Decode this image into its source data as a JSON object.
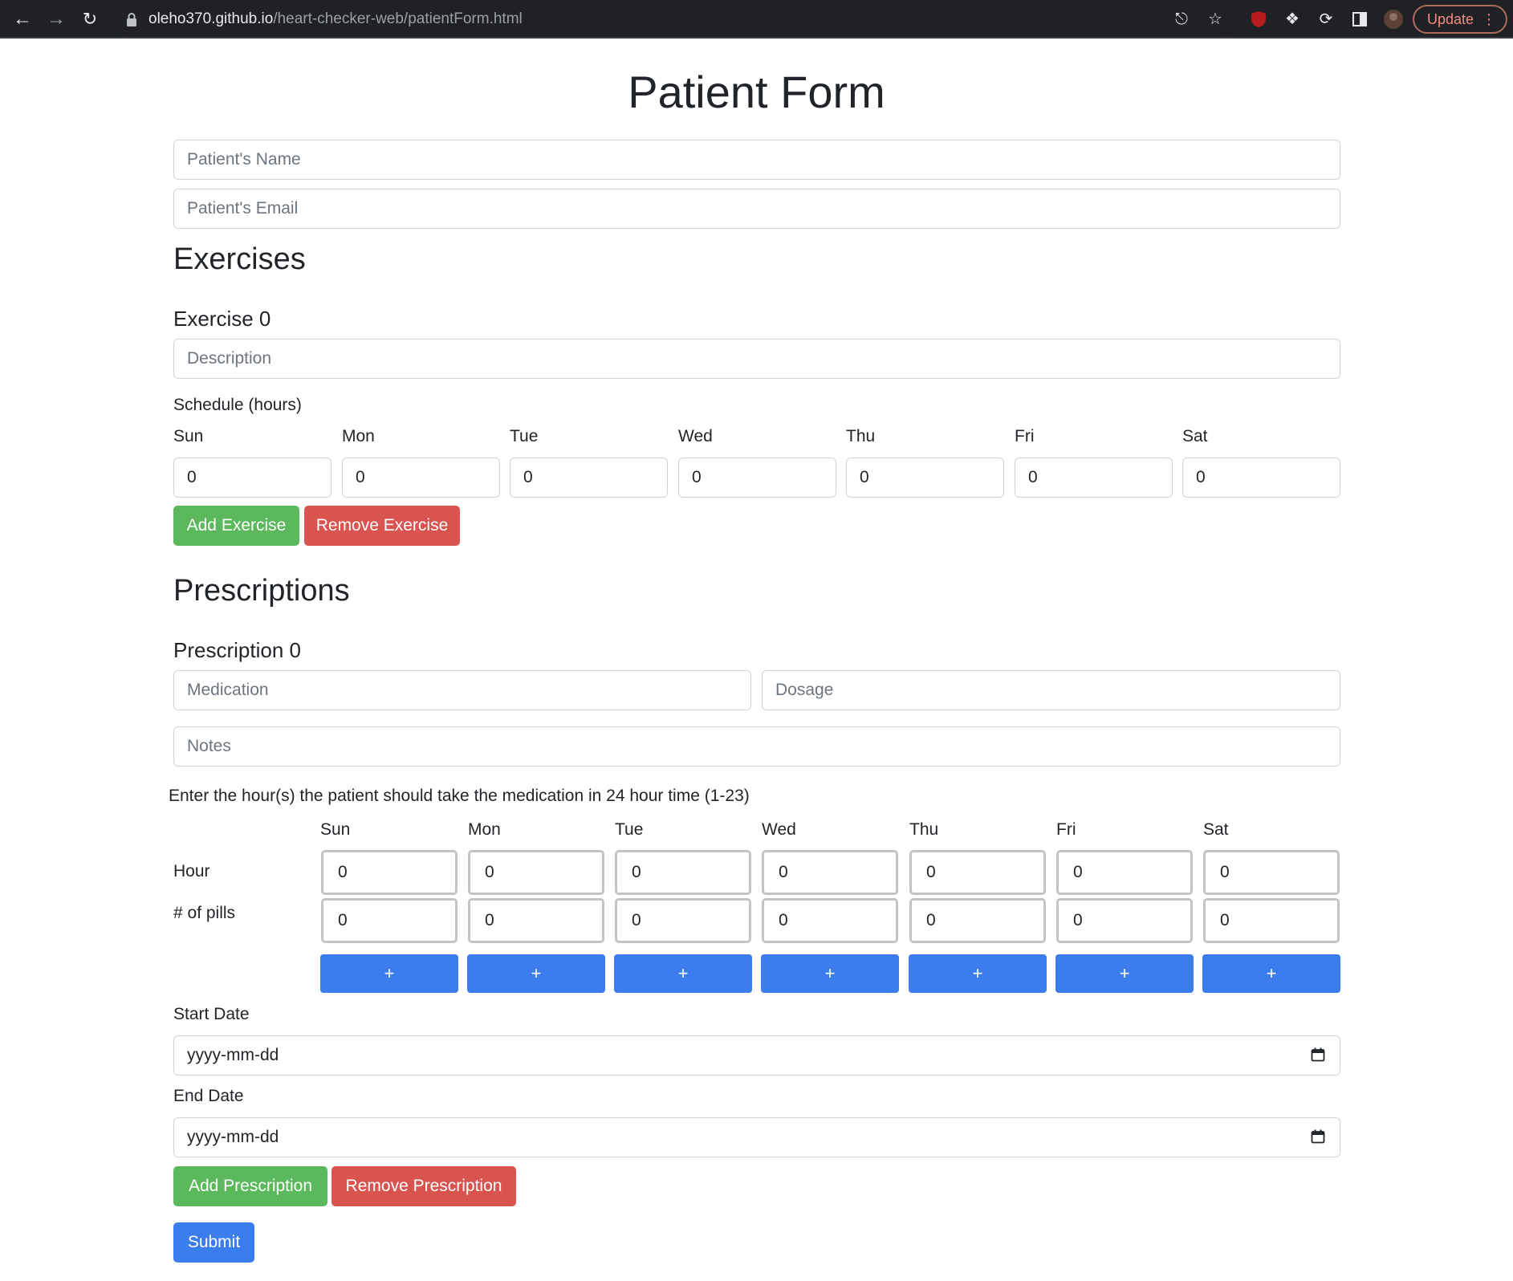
{
  "browser": {
    "url_host": "oleho370.github.io",
    "url_path": "/heart-checker-web/patientForm.html",
    "update_label": "Update"
  },
  "page": {
    "title": "Patient Form",
    "name_placeholder": "Patient's Name",
    "email_placeholder": "Patient's Email"
  },
  "exercises": {
    "heading": "Exercises",
    "item_title": "Exercise 0",
    "description_placeholder": "Description",
    "schedule_label": "Schedule (hours)",
    "days": [
      "Sun",
      "Mon",
      "Tue",
      "Wed",
      "Thu",
      "Fri",
      "Sat"
    ],
    "hours": [
      "0",
      "0",
      "0",
      "0",
      "0",
      "0",
      "0"
    ],
    "add_label": "Add Exercise",
    "remove_label": "Remove Exercise"
  },
  "prescriptions": {
    "heading": "Prescriptions",
    "item_title": "Prescription 0",
    "medication_placeholder": "Medication",
    "dosage_placeholder": "Dosage",
    "notes_placeholder": "Notes",
    "instruction": "Enter the hour(s) the patient should take the medication in 24 hour time (1-23)",
    "days": [
      "Sun",
      "Mon",
      "Tue",
      "Wed",
      "Thu",
      "Fri",
      "Sat"
    ],
    "hour_label": "Hour",
    "pills_label": "# of pills",
    "hour_values": [
      "0",
      "0",
      "0",
      "0",
      "0",
      "0",
      "0"
    ],
    "pill_values": [
      "0",
      "0",
      "0",
      "0",
      "0",
      "0",
      "0"
    ],
    "add_slot_label": "+",
    "start_date_label": "Start Date",
    "end_date_label": "End Date",
    "date_placeholder": "yyyy-mm-dd",
    "add_label": "Add Prescription",
    "remove_label": "Remove Prescription"
  },
  "submit_label": "Submit",
  "colors": {
    "success": "#5cb85c",
    "danger": "#d9534f",
    "primary": "#3b7ded"
  }
}
